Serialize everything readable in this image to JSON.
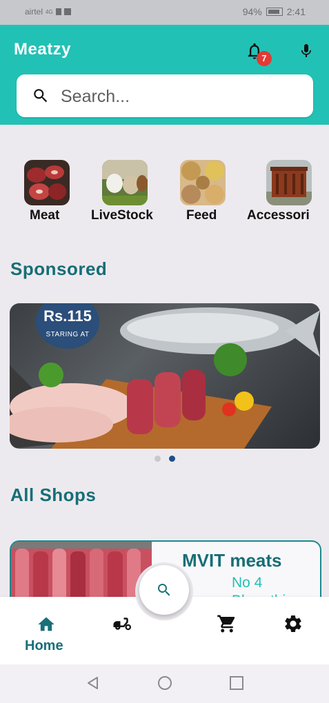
{
  "status": {
    "carrier": "airtel",
    "network": "4G",
    "battery": "94%",
    "time": "2:41"
  },
  "app": {
    "title": "Meatzy",
    "notification_count": "7"
  },
  "search": {
    "placeholder": "Search..."
  },
  "categories": [
    {
      "label": "Meat"
    },
    {
      "label": "LiveStock"
    },
    {
      "label": "Feed"
    },
    {
      "label": "Accessori"
    }
  ],
  "sponsored": {
    "title": "Sponsored",
    "banner_price": "Rs.115",
    "banner_subtitle": "STARING AT",
    "slides_total": 2,
    "active_slide": 2
  },
  "shops": {
    "title": "All Shops",
    "items": [
      {
        "name": "MVIT meats",
        "address_line1": "No 4",
        "address_line2": "Bharathiar"
      }
    ]
  },
  "bottom_nav": {
    "home_label": "Home"
  },
  "colors": {
    "teal": "#22c1b5",
    "dark_teal": "#176e76",
    "badge": "#e53935"
  }
}
